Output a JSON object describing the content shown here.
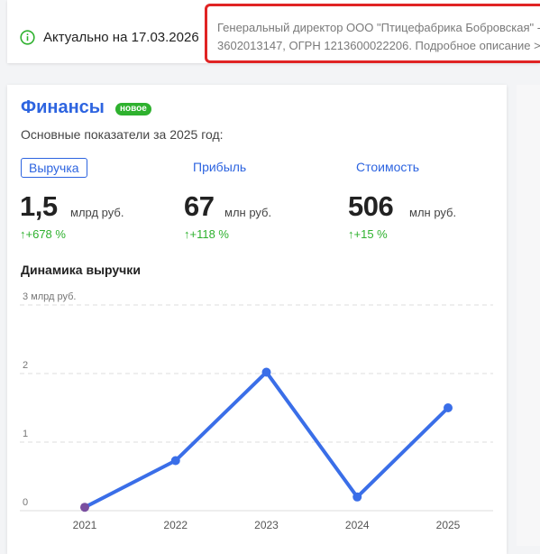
{
  "topbar": {
    "info_icon": "info-circle-icon",
    "actual_text": "Актуально на 17.03.2026",
    "description_line1": "Генеральный директор ООО \"Птицефабрика Бобровская\" -",
    "description_line2": "3602013147, ОГРН 1213600022206. Подробное описание >"
  },
  "finance": {
    "title": "Финансы",
    "badge": "новое",
    "subtitle": "Основные показатели за 2025 год:",
    "tabs": [
      {
        "label": "Выручка",
        "active": true
      },
      {
        "label": "Прибыль",
        "active": false
      },
      {
        "label": "Стоимость",
        "active": false
      }
    ],
    "metrics": [
      {
        "value": "1,5",
        "unit": "млрд руб.",
        "change": "↑+678 %"
      },
      {
        "value": "67",
        "unit": "млн руб.",
        "change": "↑+118 %"
      },
      {
        "value": "506",
        "unit": "млн руб.",
        "change": "↑+15 %"
      }
    ],
    "dynamics_title": "Динамика выручки"
  },
  "colors": {
    "accent": "#2d64e0",
    "positive": "#2eb12e",
    "line": "#3a6ee8",
    "highlight": "#e02424",
    "first_point": "#7a4fa0"
  },
  "chart_data": {
    "type": "line",
    "categories": [
      "2021",
      "2022",
      "2023",
      "2024",
      "2025"
    ],
    "x_tick_labels": [
      "2021",
      "2022",
      "2023",
      "2024",
      "2025"
    ],
    "y_tick_labels": [
      "0",
      "1",
      "2",
      "3 млрд руб."
    ],
    "y_ticks": [
      0,
      1,
      2,
      3
    ],
    "series": [
      {
        "values": [
          0.05,
          0.73,
          2.02,
          0.2,
          1.5
        ]
      }
    ],
    "xlabel": "",
    "ylabel": "млрд руб.",
    "ylim": [
      0,
      3
    ],
    "grid": true,
    "title": "Динамика выручки"
  }
}
